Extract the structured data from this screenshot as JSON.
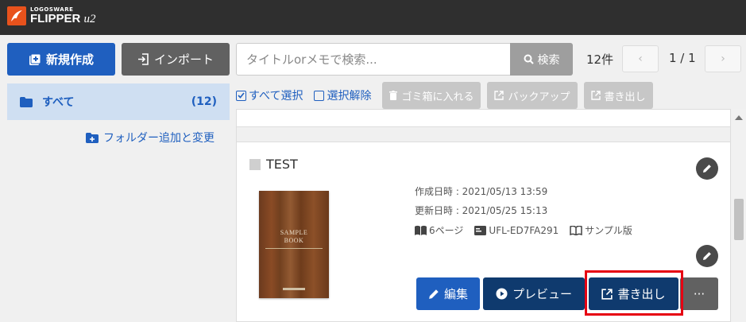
{
  "app": {
    "brand_small": "LOGOSWARE",
    "brand_name": "FLIPPER",
    "brand_suffix": "u2"
  },
  "header": {
    "new_label": "新規作成",
    "import_label": "インポート",
    "search_placeholder": "タイトルorメモで検索...",
    "search_label": "検索",
    "count": "12件",
    "page_indicator": "1 / 1",
    "prev": "‹",
    "next": "›"
  },
  "sidebar": {
    "all_label": "すべて",
    "all_count": "(12)",
    "folder_edit_label": "フォルダー追加と変更"
  },
  "toolbar": {
    "select_all": "すべて選択",
    "deselect": "選択解除",
    "trash": "ゴミ箱に入れる",
    "backup": "バックアップ",
    "export": "書き出し"
  },
  "book": {
    "title": "TEST",
    "cover_title_1": "SAMPLE",
    "cover_title_2": "BOOK",
    "created": "作成日時 : 2021/05/13 13:59",
    "updated": "更新日時 : 2021/05/25 15:13",
    "pages": "6ページ",
    "code": "UFL-ED7FA291",
    "edition": "サンプル版"
  },
  "actions": {
    "edit": "編集",
    "preview": "プレビュー",
    "export": "書き出し",
    "more": "···"
  },
  "colors": {
    "primary": "#1f5fbf",
    "dark_navy": "#0f3a6e",
    "highlight": "#e60012",
    "header_bg": "#2f2f2f"
  }
}
